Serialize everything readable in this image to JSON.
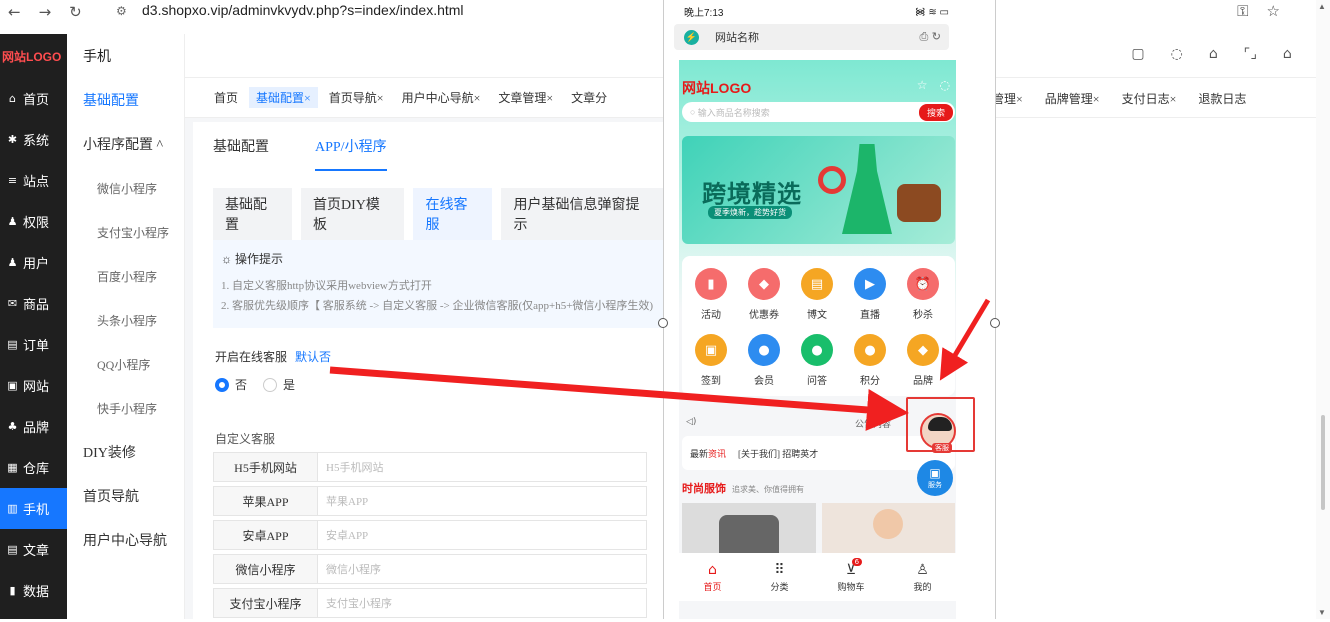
{
  "browser": {
    "url": "d3.shopxo.vip/adminvkvydv.php?s=index/index.html",
    "nav_icons": [
      "back-icon",
      "forward-icon",
      "reload-icon"
    ],
    "right_icons": [
      "add-tab-icon",
      "key-icon",
      "star-icon"
    ]
  },
  "sidebar": {
    "logo": "网站LOGO",
    "items": [
      {
        "label": "首页",
        "icon": "home-icon",
        "glyph": "⌂"
      },
      {
        "label": "系统",
        "icon": "gear-icon",
        "glyph": "✱"
      },
      {
        "label": "站点",
        "icon": "sliders-icon",
        "glyph": "≡"
      },
      {
        "label": "权限",
        "icon": "user-lock-icon",
        "glyph": "♟"
      },
      {
        "label": "用户",
        "icon": "user-icon",
        "glyph": "♟"
      },
      {
        "label": "商品",
        "icon": "mail-icon",
        "glyph": "✉"
      },
      {
        "label": "订单",
        "icon": "order-icon",
        "glyph": "▤"
      },
      {
        "label": "网站",
        "icon": "chat-icon",
        "glyph": "▣"
      },
      {
        "label": "品牌",
        "icon": "brand-icon",
        "glyph": "♣"
      },
      {
        "label": "仓库",
        "icon": "warehouse-icon",
        "glyph": "▦"
      },
      {
        "label": "手机",
        "icon": "phone-icon",
        "glyph": "▥"
      },
      {
        "label": "文章",
        "icon": "article-icon",
        "glyph": "▤"
      },
      {
        "label": "数据",
        "icon": "chart-icon",
        "glyph": "▮"
      }
    ],
    "active_index": 10
  },
  "submenu": {
    "header": "手机",
    "items": [
      {
        "label": "基础配置",
        "level": 1,
        "active": true
      },
      {
        "label": "小程序配置 ^",
        "level": 1
      },
      {
        "label": "微信小程序",
        "level": 2
      },
      {
        "label": "支付宝小程序",
        "level": 2
      },
      {
        "label": "百度小程序",
        "level": 2
      },
      {
        "label": "头条小程序",
        "level": 2
      },
      {
        "label": "QQ小程序",
        "level": 2
      },
      {
        "label": "快手小程序",
        "level": 2
      },
      {
        "label": "DIY装修",
        "level": 1
      },
      {
        "label": "首页导航",
        "level": 1
      },
      {
        "label": "用户中心导航",
        "level": 1
      }
    ]
  },
  "tabs": {
    "left": [
      "首页",
      "基础配置×",
      "首页导航×",
      "用户中心导航×",
      "文章管理×",
      "文章分"
    ],
    "active_index": 1,
    "right": [
      "库管理×",
      "品牌管理×",
      "支付日志×",
      "退款日志"
    ]
  },
  "topbar_icons": [
    "▢",
    "◌",
    "⌂",
    "⌜⌟",
    "⌂",
    "◌"
  ],
  "panel": {
    "subtabs": [
      "基础配置",
      "APP/小程序"
    ],
    "subtab_active": 1,
    "cattabs": [
      "基础配置",
      "首页DIY模板",
      "在线客服",
      "用户基础信息弹窗提示"
    ],
    "cattab_active": 2,
    "tips_title": "操作提示",
    "tips_lines": [
      "1. 自定义客服http协议采用webview方式打开",
      "2. 客服优先级顺序【 客服系统 -> 自定义客服 -> 企业微信客服(仅app+h5+微信小程序生效)"
    ],
    "onoff_label": "开启在线客服",
    "onoff_default": "默认否",
    "radio_no": "否",
    "radio_yes": "是",
    "custom_label": "自定义客服",
    "fields": [
      {
        "label": "H5手机网站",
        "placeholder": "H5手机网站"
      },
      {
        "label": "苹果APP",
        "placeholder": "苹果APP"
      },
      {
        "label": "安卓APP",
        "placeholder": "安卓APP"
      },
      {
        "label": "微信小程序",
        "placeholder": "微信小程序"
      },
      {
        "label": "支付宝小程序",
        "placeholder": "支付宝小程序"
      }
    ]
  },
  "phone": {
    "time": "晚上7:13",
    "signal": "᯼ ≋ ▭",
    "site_name": "网站名称",
    "logo": "网站LOGO",
    "search_placeholder": "输入商品名称搜索",
    "search_btn": "搜索",
    "banner_title": "跨境精选",
    "banner_sub": "夏季焕新，趁势好货",
    "grid": [
      {
        "label": "活动",
        "color": "#f56c6c"
      },
      {
        "label": "优惠券",
        "color": "#f56c6c"
      },
      {
        "label": "博文",
        "color": "#f5a623"
      },
      {
        "label": "直播",
        "color": "#2d8cf0"
      },
      {
        "label": "秒杀",
        "color": "#f56c6c"
      },
      {
        "label": "签到",
        "color": "#f5a623"
      },
      {
        "label": "会员",
        "color": "#2d8cf0"
      },
      {
        "label": "问答",
        "color": "#19be6b"
      },
      {
        "label": "积分",
        "color": "#f5a623"
      },
      {
        "label": "品牌",
        "color": "#f5a623"
      }
    ],
    "notice": "公告内容",
    "news_label": "最新",
    "news_red": "资讯",
    "news_item": "[关于我们] 招聘英才",
    "fashion": "时尚服饰",
    "fashion_sub": "追求美、你值得拥有",
    "footer": [
      {
        "label": "首页",
        "glyph": "⌂"
      },
      {
        "label": "分类",
        "glyph": "⠿"
      },
      {
        "label": "购物车",
        "glyph": "⊻"
      },
      {
        "label": "我的",
        "glyph": "♙"
      }
    ],
    "cart_badge": "6",
    "kefu_tag": "客服",
    "service_label": "服务"
  }
}
